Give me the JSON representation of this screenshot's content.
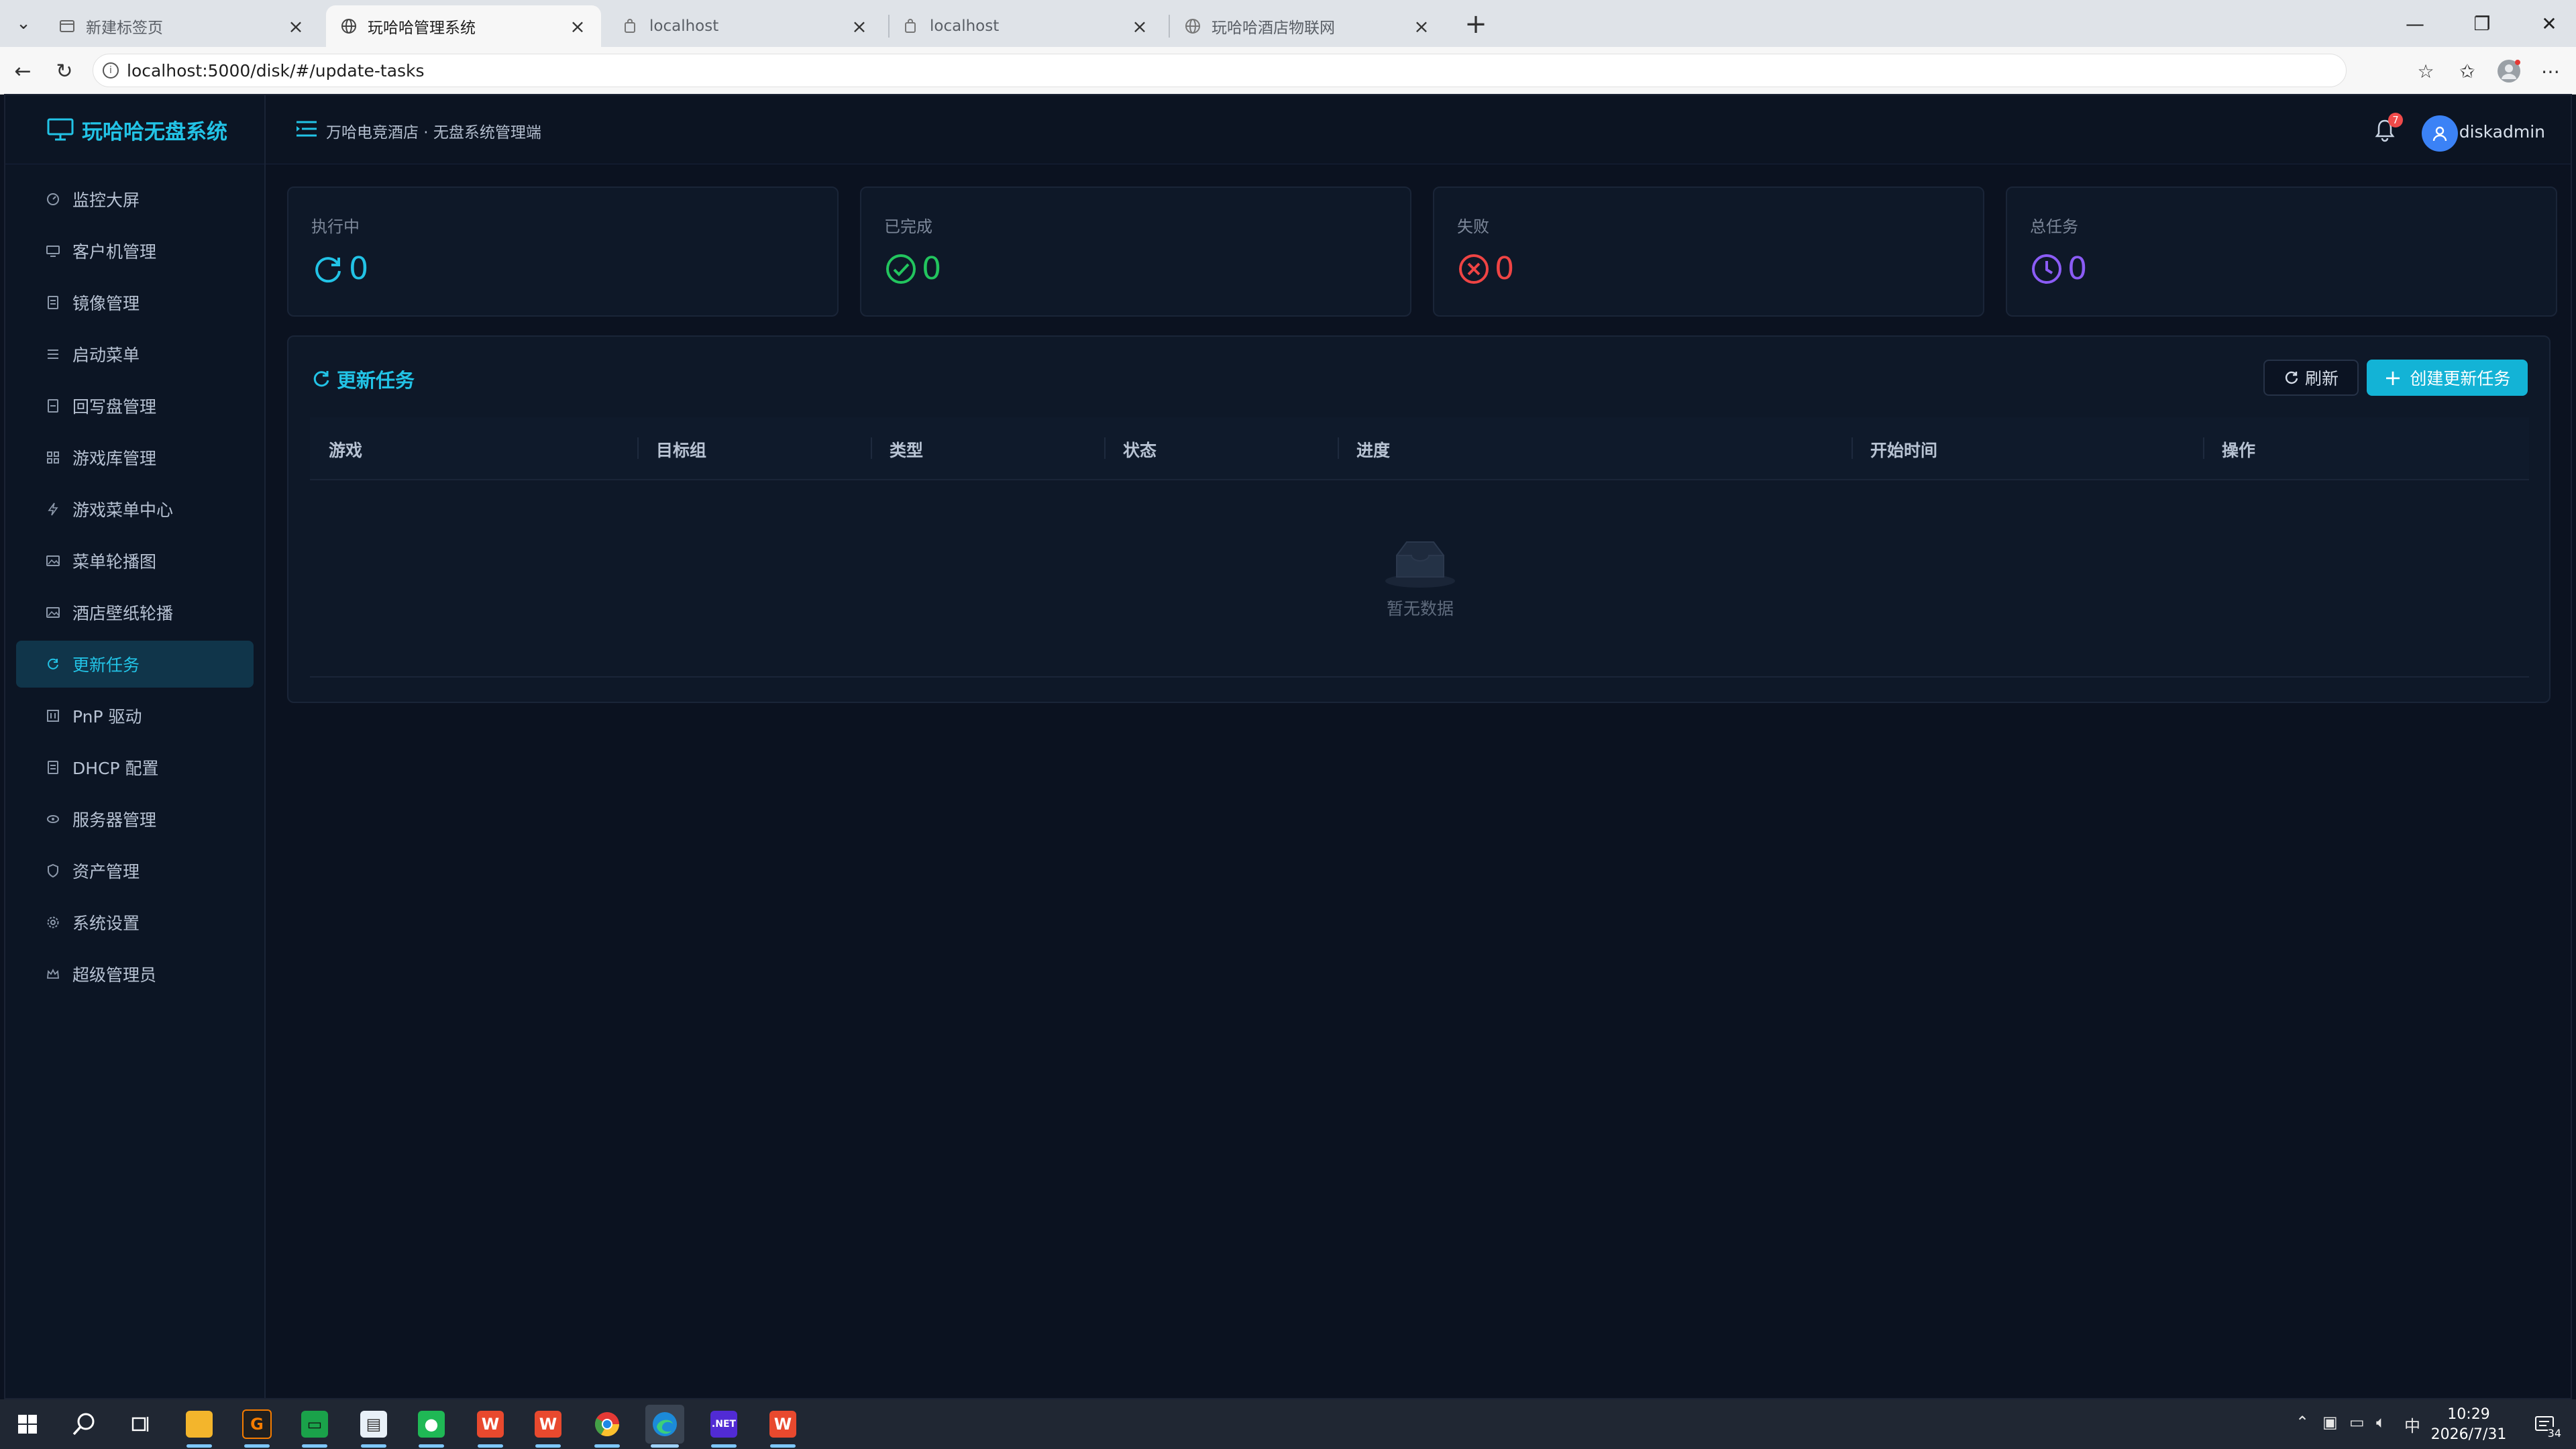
{
  "browser": {
    "tabs": [
      {
        "label": "新建标签页",
        "active": false
      },
      {
        "label": "玩哈哈管理系统",
        "active": true
      },
      {
        "label": "localhost",
        "active": false
      },
      {
        "label": "localhost",
        "active": false
      },
      {
        "label": "玩哈哈酒店物联网",
        "active": false
      }
    ],
    "url": "localhost:5000/disk/#/update-tasks"
  },
  "sidebar": {
    "brand": "玩哈哈无盘系统",
    "items": [
      {
        "label": "监控大屏",
        "icon": "dashboard-icon"
      },
      {
        "label": "客户机管理",
        "icon": "monitor-icon"
      },
      {
        "label": "镜像管理",
        "icon": "disk-image-icon"
      },
      {
        "label": "启动菜单",
        "icon": "list-icon"
      },
      {
        "label": "回写盘管理",
        "icon": "writeback-icon"
      },
      {
        "label": "游戏库管理",
        "icon": "grid-icon"
      },
      {
        "label": "游戏菜单中心",
        "icon": "lightning-icon"
      },
      {
        "label": "菜单轮播图",
        "icon": "picture-icon"
      },
      {
        "label": "酒店壁纸轮播",
        "icon": "picture-icon"
      },
      {
        "label": "更新任务",
        "icon": "refresh-icon",
        "active": true
      },
      {
        "label": "PnP 驱动",
        "icon": "driver-icon"
      },
      {
        "label": "DHCP 配置",
        "icon": "network-icon"
      },
      {
        "label": "服务器管理",
        "icon": "server-icon"
      },
      {
        "label": "资产管理",
        "icon": "shield-icon"
      },
      {
        "label": "系统设置",
        "icon": "gear-icon"
      },
      {
        "label": "超级管理员",
        "icon": "crown-icon"
      }
    ]
  },
  "header": {
    "breadcrumb": "万哈电竞酒店 · 无盘系统管理端",
    "notifications": "7",
    "username": "diskadmin"
  },
  "stats": [
    {
      "label": "执行中",
      "value": "0",
      "color": "#22c3e6",
      "icon": "sync-icon"
    },
    {
      "label": "已完成",
      "value": "0",
      "color": "#22c55e",
      "icon": "check-circle-icon"
    },
    {
      "label": "失败",
      "value": "0",
      "color": "#ef4444",
      "icon": "x-circle-icon"
    },
    {
      "label": "总任务",
      "value": "0",
      "color": "#8b5cf6",
      "icon": "clock-icon"
    }
  ],
  "panel": {
    "title": "更新任务",
    "refresh_label": "刷新",
    "create_label": "创建更新任务",
    "columns": [
      "游戏",
      "目标组",
      "类型",
      "状态",
      "进度",
      "开始时间",
      "操作"
    ],
    "rows": [],
    "empty_text": "暂无数据"
  },
  "taskbar": {
    "apps": [
      "file-explorer-icon",
      "git-icon",
      "terminal-icon",
      "notepad-icon",
      "wechat-icon",
      "wps-icon",
      "wps-icon",
      "chrome-icon",
      "edge-icon",
      "dotnet-icon",
      "wps-icon"
    ],
    "dotnet_label": ".NET",
    "ime": "中",
    "time": "10:29",
    "date": "2026/7/31",
    "notification_count": "34"
  },
  "colors": {
    "accent": "#22c3e6",
    "background": "#0b1220",
    "card": "#0e1828"
  }
}
